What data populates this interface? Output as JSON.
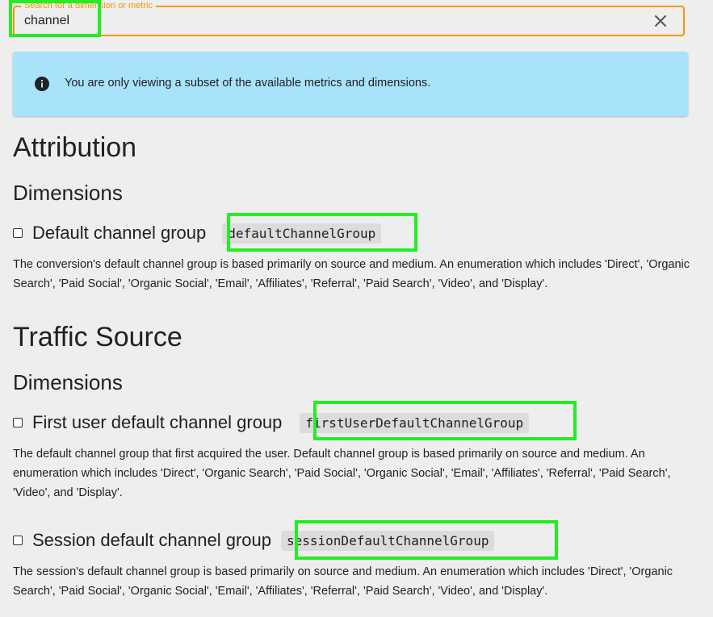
{
  "search": {
    "label": "Search for a dimension or metric",
    "value": "channel",
    "clear_icon": "close-icon"
  },
  "info_banner": {
    "icon": "info-icon",
    "text": "You are only viewing a subset of the available metrics and dimensions."
  },
  "sections": [
    {
      "title": "Attribution",
      "subtitle": "Dimensions",
      "fields": [
        {
          "name": "Default channel group",
          "api_name": "defaultChannelGroup",
          "description": "The conversion's default channel group is based primarily on source and medium. An enumeration which includes 'Direct', 'Organic Search', 'Paid Social', 'Organic Social', 'Email', 'Affiliates', 'Referral', 'Paid Search', 'Video', and 'Display'."
        }
      ]
    },
    {
      "title": "Traffic Source",
      "subtitle": "Dimensions",
      "fields": [
        {
          "name": "First user default channel group",
          "api_name": "firstUserDefaultChannelGroup",
          "description": "The default channel group that first acquired the user. Default channel group is based primarily on source and medium. An enumeration which includes 'Direct', 'Organic Search', 'Paid Social', 'Organic Social', 'Email', 'Affiliates', 'Referral', 'Paid Search', 'Video', and 'Display'."
        },
        {
          "name": "Session default channel group",
          "api_name": "sessionDefaultChannelGroup",
          "description": "The session's default channel group is based primarily on source and medium. An enumeration which includes 'Direct', 'Organic Search', 'Paid Social', 'Organic Social', 'Email', 'Affiliates', 'Referral', 'Paid Search', 'Video', and 'Display'."
        }
      ]
    }
  ],
  "colors": {
    "accent": "#f29900",
    "banner": "#a8e3fb",
    "highlight": "#22ee22",
    "background": "#eeeeee"
  }
}
